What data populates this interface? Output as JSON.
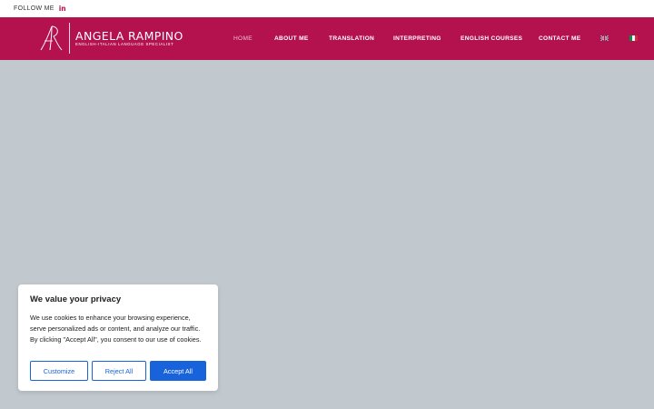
{
  "topbar": {
    "follow_label": "FOLLOW ME",
    "social_icon": "linkedin-icon",
    "social_glyph": "in"
  },
  "brand": {
    "name": "ANGELA RAMPINO",
    "tagline": "ENGLISH-ITALIAN LANGUAGE SPECIALIST",
    "monogram_icon": "ar-monogram-logo",
    "color": "#b4124f"
  },
  "nav": {
    "items": [
      {
        "label": "HOME",
        "active": true
      },
      {
        "label": "ABOUT ME"
      },
      {
        "label": "TRANSLATION"
      },
      {
        "label": "INTERPRETING"
      },
      {
        "label": "ENGLISH COURSES"
      },
      {
        "label": "CONTACT ME"
      }
    ],
    "flags": [
      {
        "icon": "uk-flag-icon"
      },
      {
        "icon": "italy-flag-icon"
      }
    ]
  },
  "cookie_banner": {
    "title": "We value your privacy",
    "text": "We use cookies to enhance your browsing experience, serve personalized ads or content, and analyze our traffic. By clicking \"Accept All\", you consent to our use of cookies.",
    "customize_label": "Customize",
    "reject_label": "Reject All",
    "accept_label": "Accept All",
    "accent_color": "#1863dc"
  },
  "hero": {
    "background": "#c2c9ce"
  }
}
